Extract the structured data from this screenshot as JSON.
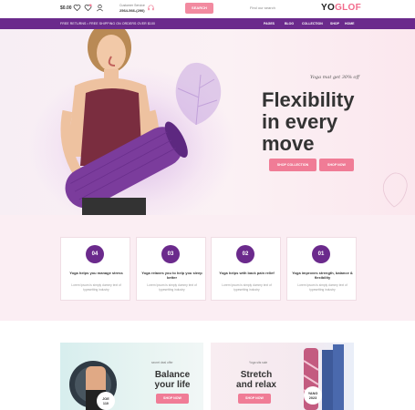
{
  "header": {
    "cart_total": "$0.00",
    "support_label": "Customer Service",
    "support_phone": "2564-566-(290)",
    "search_button": "SEARCH",
    "search_placeholder": "Find our search",
    "logo_prefix": "YO",
    "logo_suffix": "GLOF"
  },
  "nav": {
    "promo": "FREE RETURNS • FREE SHIPPING ON ORDERS OVER $100",
    "items": [
      "PAGES",
      "BLOG",
      "COLLECTION",
      "SHOP",
      "HOME"
    ]
  },
  "hero": {
    "tagline": "Yoga mat get 30% off",
    "title_lines": [
      "Flexibility",
      "in every",
      "move"
    ],
    "shop_collection": "SHOP COLLECTION",
    "shop_now": "SHOP NOW"
  },
  "features": [
    {
      "number": "04",
      "title": "Yoga helps you manage stress",
      "text": "Lorem Ipsum is simply dummy text of typesetting industry"
    },
    {
      "number": "03",
      "title": "Yoga relaxes you to help you sleep better",
      "text": "Lorem Ipsum is simply dummy text of typesetting industry"
    },
    {
      "number": "02",
      "title": "Yoga helps with back pain relief",
      "text": "Lorem Ipsum is simply dummy text of typesetting industry"
    },
    {
      "number": "01",
      "title": "Yoga improves strength, balance & flexibility",
      "text": "Lorem Ipsum is simply dummy text of typesetting industry"
    }
  ],
  "promos": [
    {
      "sub": "secret deal offer",
      "title_lines": [
        "Balance",
        "your life"
      ],
      "button": "SHOP NOW",
      "badge_lines": [
        "JOE",
        "110"
      ]
    },
    {
      "sub": "Yoga sits sale",
      "title_lines": [
        "Stretch",
        "and relax"
      ],
      "button": "SHOP NOW",
      "badge_lines": [
        "YANG",
        "2023"
      ]
    }
  ],
  "colors": {
    "accent": "#f07c96",
    "brand": "#6b2a8c"
  }
}
